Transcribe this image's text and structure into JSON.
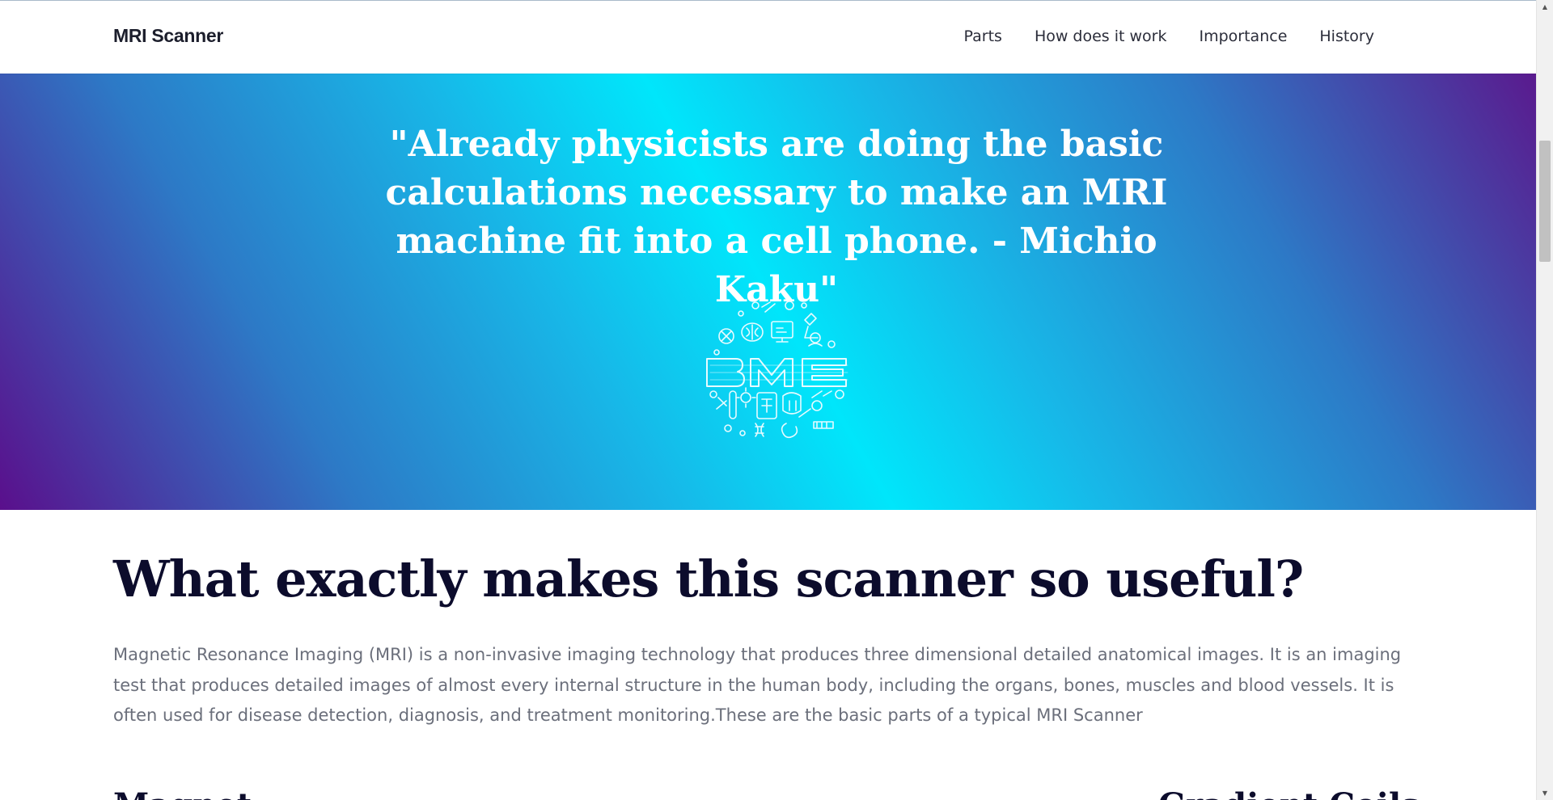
{
  "navbar": {
    "brand": "MRI Scanner",
    "links": [
      "Parts",
      "How does it work",
      "Importance",
      "History"
    ]
  },
  "hero": {
    "quote": "\"Already physicists are doing the basic calculations necessary to make an MRI machine fit into a cell phone. - Michio Kaku\"",
    "logo_text": "BME"
  },
  "main": {
    "title": "What exactly makes this scanner so useful?",
    "intro": "Magnetic Resonance Imaging (MRI) is a non-invasive imaging technology that produces three dimensional detailed anatomical images. It is an imaging test that produces detailed images of almost every internal structure in the human body, including the organs, bones, muscles and blood vessels. It is often used for disease detection, diagnosis, and treatment monitoring.These are the basic parts of a typical MRI Scanner",
    "sub_left": "Magnet",
    "sub_right": "Gradient Coils"
  },
  "scrollbar": {
    "up_glyph": "▲",
    "down_glyph": "▼"
  },
  "colors": {
    "hero_gradient": [
      "#5a0f8c",
      "#2d79c6",
      "#00e6fb"
    ],
    "title": "#0c0c2c",
    "body_text": "#6b6f7b"
  },
  "icons": [
    "bme-logo-icon"
  ]
}
